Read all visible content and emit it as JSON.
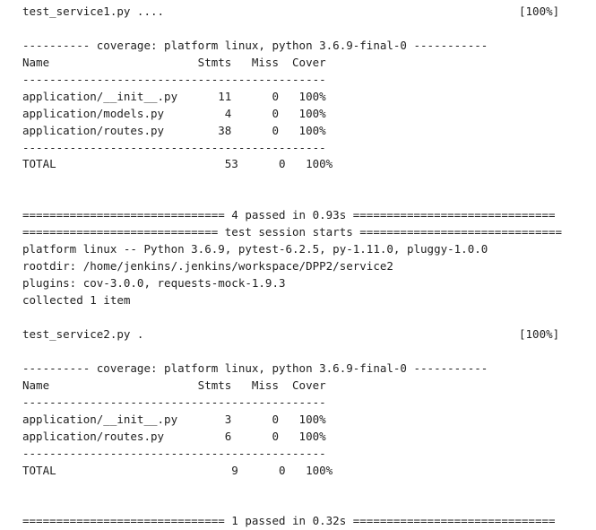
{
  "output": {
    "run1": {
      "test_line": "test_service1.py ....",
      "progress": "[100%]",
      "coverage_header": "---------- coverage: platform linux, python 3.6.9-final-0 -----------",
      "table_header": "Name                      Stmts   Miss  Cover",
      "separator_top": "---------------------------------------------",
      "rows": [
        "application/__init__.py      11      0   100%",
        "application/models.py         4      0   100%",
        "application/routes.py        38      0   100%"
      ],
      "separator_bottom": "---------------------------------------------",
      "total": "TOTAL                         53      0   100%",
      "passed": "============================== 4 passed in 0.93s =============================="
    },
    "session": {
      "starts": "============================= test session starts ==============================",
      "platform": "platform linux -- Python 3.6.9, pytest-6.2.5, py-1.11.0, pluggy-1.0.0",
      "rootdir": "rootdir: /home/jenkins/.jenkins/workspace/DPP2/service2",
      "plugins": "plugins: cov-3.0.0, requests-mock-1.9.3",
      "collected": "collected 1 item"
    },
    "run2": {
      "test_line": "test_service2.py .",
      "progress": "[100%]",
      "coverage_header": "---------- coverage: platform linux, python 3.6.9-final-0 -----------",
      "table_header": "Name                      Stmts   Miss  Cover",
      "separator_top": "---------------------------------------------",
      "rows": [
        "application/__init__.py       3      0   100%",
        "application/routes.py         6      0   100%"
      ],
      "separator_bottom": "---------------------------------------------",
      "total": "TOTAL                          9      0   100%",
      "passed": "============================== 1 passed in 0.32s =============================="
    }
  }
}
